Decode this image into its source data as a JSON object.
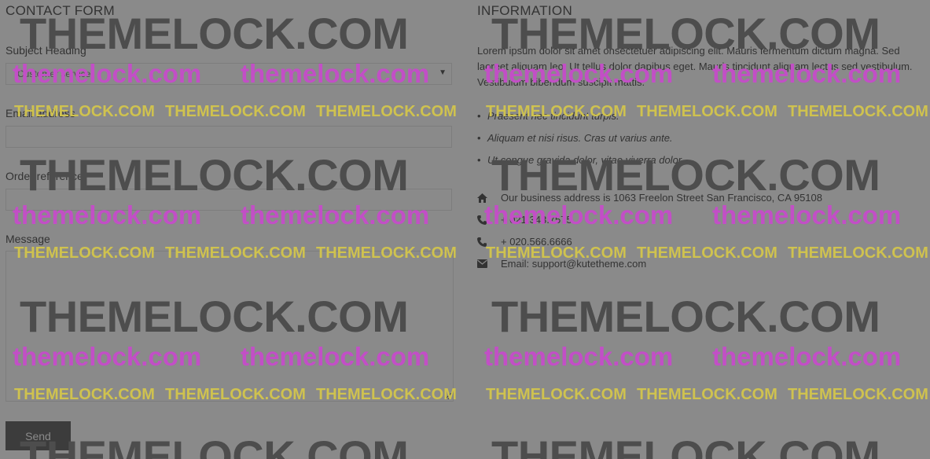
{
  "contact_form": {
    "title": "CONTACT FORM",
    "subject_label": "Subject Heading",
    "subject_value": "Customer service",
    "email_label": "Email address",
    "email_value": "",
    "order_label": "Order reference",
    "order_value": "",
    "message_label": "Message",
    "message_value": "",
    "send_label": "Send"
  },
  "information": {
    "title": "INFORMATION",
    "intro": "Lorem ipsum dolor sit amet onsectetuer adipiscing elit. Mauris fermentum dictum magna. Sed laoreet aliquam leo. Ut tellus dolor dapibus eget. Mauris tincidunt aliquam lectus sed vestibulum. Vestibulum bibendum suscipit mattis.",
    "bullets": [
      "Praesent nec tincidunt turpis.",
      "Aliquam et nisi risus. Cras ut varius ante.",
      "Ut congue gravida dolor, vitae viverra dolor."
    ],
    "contacts": [
      {
        "icon": "home-icon",
        "text": "Our business address is 1063 Freelon Street San Francisco, CA 95108"
      },
      {
        "icon": "phone-icon",
        "text": "+ 021.343.7575"
      },
      {
        "icon": "phone-icon",
        "text": "+ 020.566.6666"
      },
      {
        "icon": "envelope-icon",
        "text": "Email: support@kutetheme.com"
      }
    ]
  },
  "watermark": {
    "big": "THEMELOCK.COM",
    "lower": "themelock.com",
    "small": "THEMELOCK.COM"
  },
  "colors": {
    "background": "#8a8a8a",
    "text": "#333333",
    "button": "#3c3c3c",
    "watermark_dark": "#4d4d4d",
    "watermark_pink": "#c24fc6",
    "watermark_yellow": "#cfc24f"
  }
}
